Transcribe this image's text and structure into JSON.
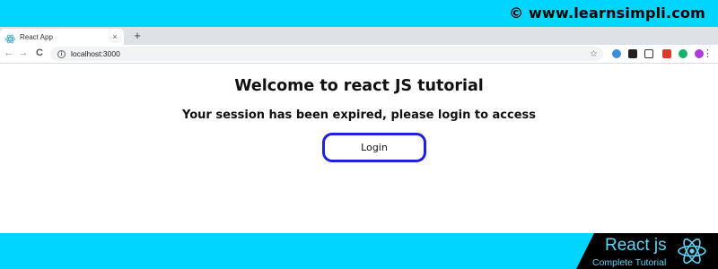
{
  "watermark": {
    "text": "©  www.learnsimpli.com"
  },
  "browser": {
    "tab": {
      "title": "React App",
      "close": "×"
    },
    "new_tab": "+",
    "nav": {
      "back": "←",
      "forward": "→",
      "reload": "C"
    },
    "address": {
      "url": "localhost:3000"
    },
    "extensions": [
      "cloud-icon",
      "ob-icon",
      "screen-icon",
      "pdf-icon",
      "grammarly-icon",
      "profile-icon"
    ],
    "menu": "⋮"
  },
  "page": {
    "heading": "Welcome to react JS tutorial",
    "message": "Your session has been expired, please login to access",
    "login_button": "Login"
  },
  "branding": {
    "title": "React js",
    "subtitle": "Complete Tutorial"
  },
  "colors": {
    "banner": "#00d5ff",
    "button_border": "#2020e0",
    "logo_text": "#5fd4f4"
  }
}
